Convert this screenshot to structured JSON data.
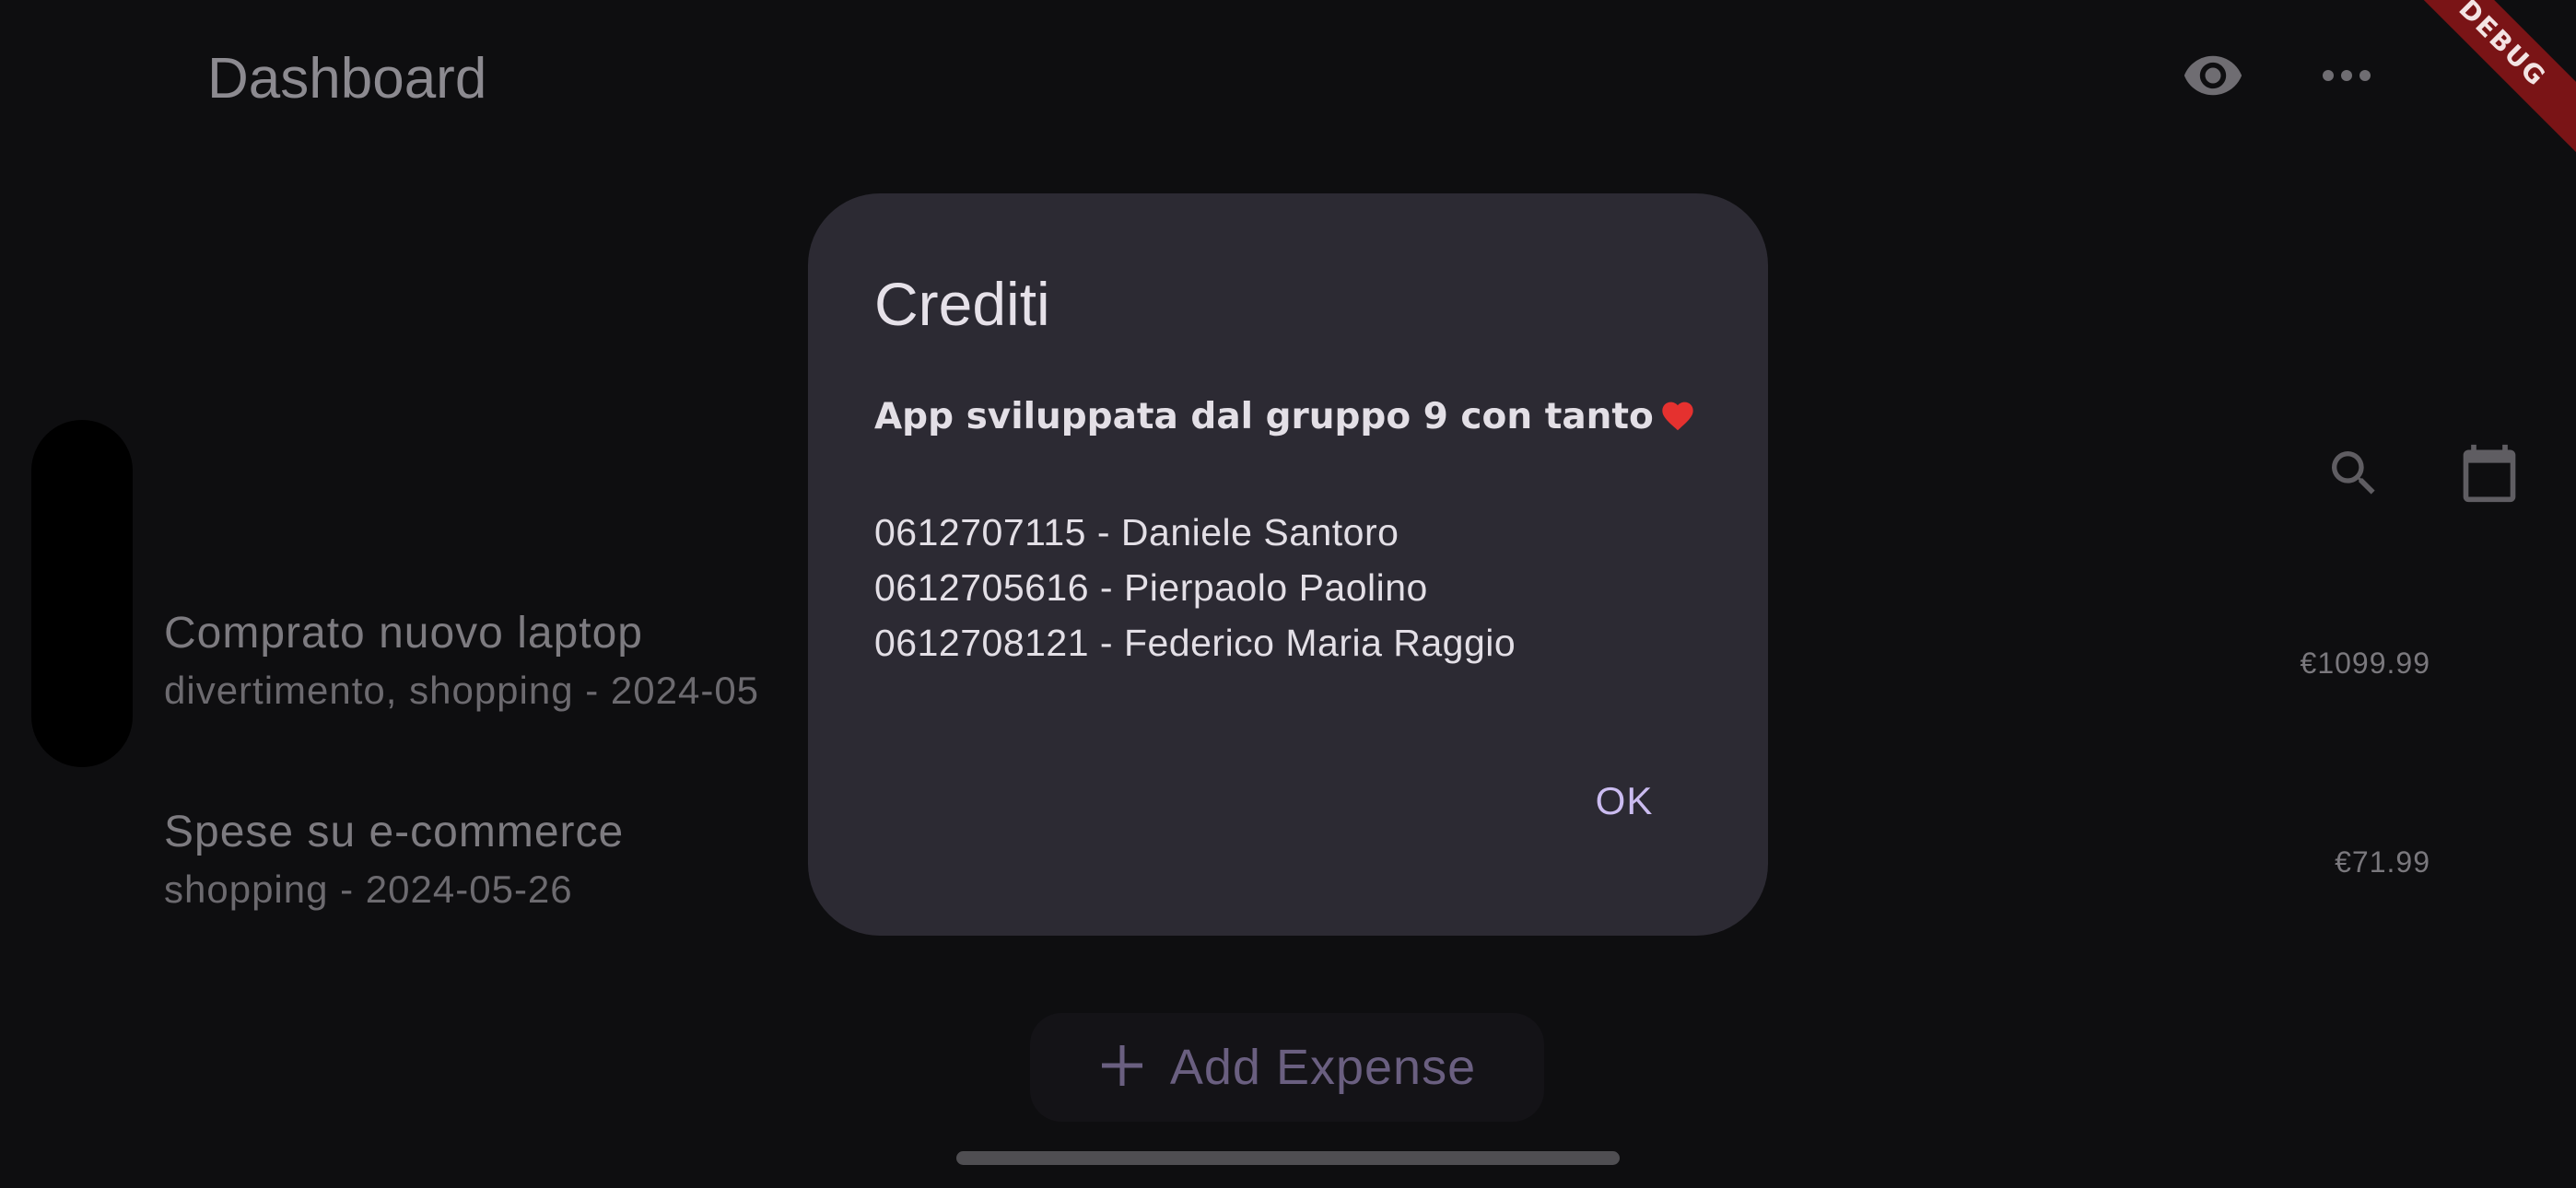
{
  "app_bar": {
    "title": "Dashboard",
    "icons": [
      "eye-icon",
      "more-horizontal-icon"
    ]
  },
  "debug_banner": "DEBUG",
  "toolbar": {
    "icons": [
      "search-icon",
      "calendar-icon"
    ]
  },
  "expenses": [
    {
      "title": "Comprato nuovo laptop",
      "subtitle": "divertimento, shopping - 2024-05",
      "amount": "€1099.99"
    },
    {
      "title": "Spese su e-commerce",
      "subtitle": "shopping - 2024-05-26",
      "amount": "€71.99"
    }
  ],
  "fab": {
    "icon": "plus-icon",
    "label": "Add Expense"
  },
  "dialog": {
    "title": "Crediti",
    "heading": "App sviluppata dal gruppo 9 con tanto",
    "heading_icon": "heart-icon",
    "credits": [
      "0612707115 - Daniele Santoro",
      "0612705616 - Pierpaolo Paolino",
      "0612708121 - Federico Maria Raggio"
    ],
    "ok_label": "OK"
  },
  "colors": {
    "background": "#0e0e10",
    "dialog_surface": "#2c2a33",
    "accent": "#cbbcf0",
    "debug_banner": "#7a1416",
    "heart": "#e5312f"
  }
}
